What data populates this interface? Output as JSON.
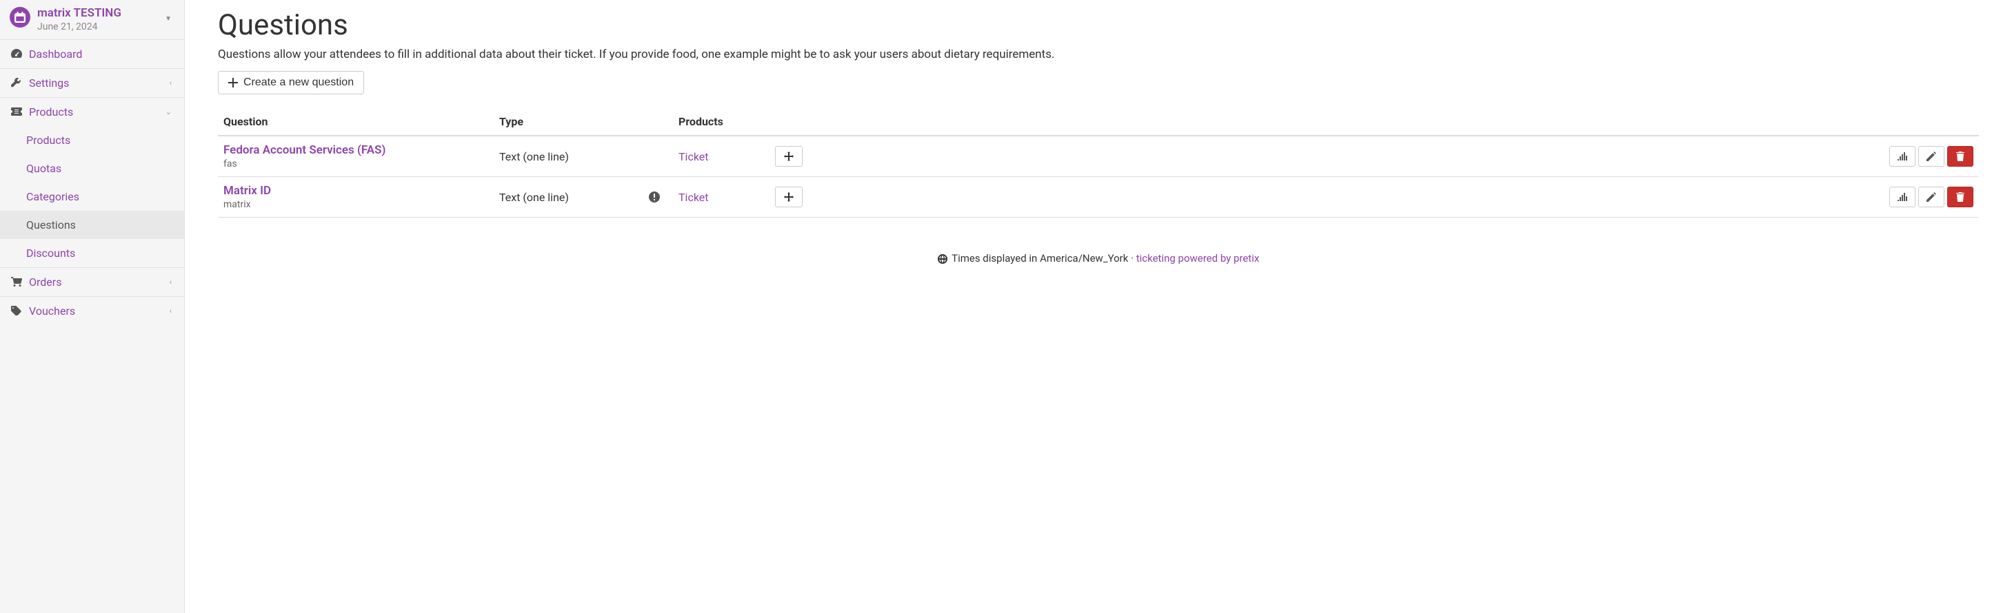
{
  "event": {
    "title": "matrix TESTING",
    "date": "June 21, 2024"
  },
  "nav": {
    "dashboard": "Dashboard",
    "settings": "Settings",
    "products": "Products",
    "products_sub": {
      "products": "Products",
      "quotas": "Quotas",
      "categories": "Categories",
      "questions": "Questions",
      "discounts": "Discounts"
    },
    "orders": "Orders",
    "vouchers": "Vouchers"
  },
  "page": {
    "title": "Questions",
    "intro": "Questions allow your attendees to fill in additional data about their ticket. If you provide food, one example might be to ask your users about dietary requirements.",
    "create_button": "Create a new question"
  },
  "table": {
    "col_question": "Question",
    "col_type": "Type",
    "col_products": "Products"
  },
  "questions": [
    {
      "name": "Fedora Account Services (FAS)",
      "slug": "fas",
      "type": "Text (one line)",
      "product": "Ticket",
      "warning": false
    },
    {
      "name": "Matrix ID",
      "slug": "matrix",
      "type": "Text (one line)",
      "product": "Ticket",
      "warning": true
    }
  ],
  "footer": {
    "timezone": "Times displayed in America/New_York",
    "separator": " · ",
    "link": "ticketing powered by pretix"
  }
}
